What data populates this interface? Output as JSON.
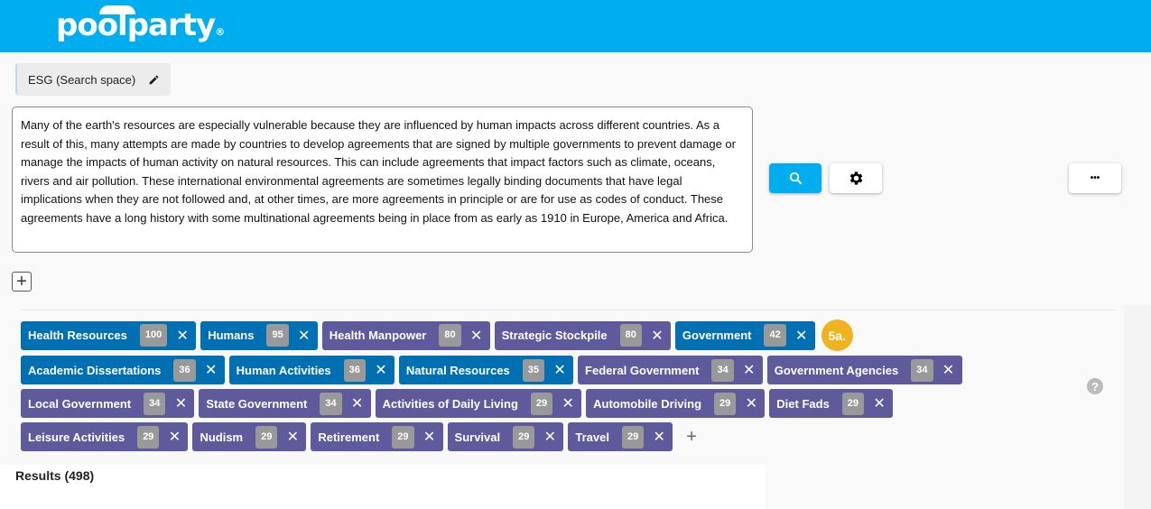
{
  "header": {
    "logo_text": "poolparty",
    "logo_mark": "®",
    "bg_color": "#00aeef"
  },
  "search_space": {
    "label": "ESG (Search space)",
    "icon": "pencil-icon"
  },
  "query": {
    "value": "Many of the earth's resources are especially vulnerable because they are influenced by human impacts across different countries. As a result of this, many attempts are made by countries to develop agreements that are signed by multiple governments to prevent damage or manage the impacts of human activity on natural resources. This can include agreements that impact factors such as climate, oceans, rivers and air pollution. These international environmental agreements are sometimes legally binding documents that have legal implications when they are not followed and, at other times, are more agreements in principle or are for use as codes of conduct. These agreements have a long history with some multinational agreements being in place from as early as 1910 in Europe, America and Africa."
  },
  "toolbar": {
    "search_icon": "search-icon",
    "settings_icon": "gear-icon",
    "more_icon": "more-horizontal-icon",
    "add_icon": "plus-icon",
    "more_label": "•••"
  },
  "colors": {
    "blue_chip": "#0070b3",
    "purple_chip": "#5e5a9b",
    "count": "#999999",
    "step_badge": "#efb320"
  },
  "tag_rows": [
    [
      {
        "label": "Health Resources",
        "count": "100",
        "color": "blue"
      },
      {
        "label": "Humans",
        "count": "95",
        "color": "blue"
      },
      {
        "label": "Health Manpower",
        "count": "80",
        "color": "purple"
      },
      {
        "label": "Strategic Stockpile",
        "count": "80",
        "color": "purple"
      },
      {
        "label": "Government",
        "count": "42",
        "color": "blue"
      }
    ],
    [
      {
        "label": "Academic Dissertations",
        "count": "36",
        "color": "blue"
      },
      {
        "label": "Human Activities",
        "count": "36",
        "color": "blue"
      },
      {
        "label": "Natural Resources",
        "count": "35",
        "color": "blue"
      },
      {
        "label": "Federal Government",
        "count": "34",
        "color": "purple"
      },
      {
        "label": "Government Agencies",
        "count": "34",
        "color": "purple"
      }
    ],
    [
      {
        "label": "Local Government",
        "count": "34",
        "color": "purple"
      },
      {
        "label": "State Government",
        "count": "34",
        "color": "purple"
      },
      {
        "label": "Activities of Daily Living",
        "count": "29",
        "color": "purple"
      },
      {
        "label": "Automobile Driving",
        "count": "29",
        "color": "purple"
      },
      {
        "label": "Diet Fads",
        "count": "29",
        "color": "purple"
      }
    ],
    [
      {
        "label": "Leisure Activities",
        "count": "29",
        "color": "purple"
      },
      {
        "label": "Nudism",
        "count": "29",
        "color": "purple"
      },
      {
        "label": "Retirement",
        "count": "29",
        "color": "purple"
      },
      {
        "label": "Survival",
        "count": "29",
        "color": "purple"
      },
      {
        "label": "Travel",
        "count": "29",
        "color": "purple"
      }
    ]
  ],
  "step_badge": "5a.",
  "help": "?",
  "results": {
    "label": "Results (498)"
  }
}
